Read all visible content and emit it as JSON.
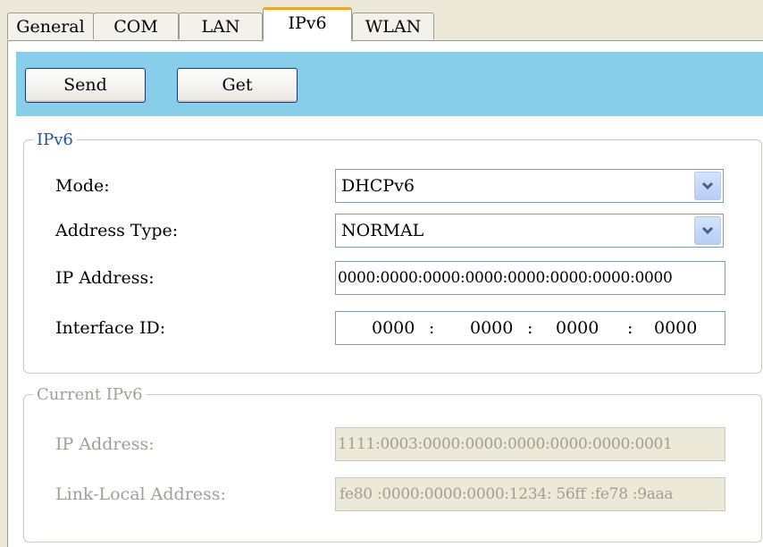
{
  "tabs": [
    "General",
    "COM",
    "LAN",
    "IPv6",
    "WLAN"
  ],
  "toolbar": {
    "send_label": "Send",
    "get_label": "Get"
  },
  "ipv6": {
    "legend": "IPv6",
    "mode_label": "Mode:",
    "mode_value": "DHCPv6",
    "address_type_label": "Address Type:",
    "address_type_value": "NORMAL",
    "ip_label": "IP Address:",
    "ip_value": "0000:0000:0000:0000:0000:0000:0000:0000",
    "iface_label": "Interface ID:",
    "iface_segments": [
      "0000",
      "0000",
      "0000",
      "0000"
    ],
    "iface_separator": ":"
  },
  "current": {
    "legend": "Current IPv6",
    "ip_label": "IP Address:",
    "ip_value": "1111:0003:0000:0000:0000:0000:0000:0001",
    "link_label": "Link-Local Address:",
    "link_value": "fe80 :0000:0000:0000:1234: 56ff :fe78 :9aaa"
  },
  "colors": {
    "toolbar": "#87ceeb",
    "active_tab_accent": "#f3a32b",
    "legend_blue": "#1c4fb8",
    "disabled_text": "#a09f96"
  },
  "icons": {
    "dropdown": "chevron-down-icon"
  }
}
